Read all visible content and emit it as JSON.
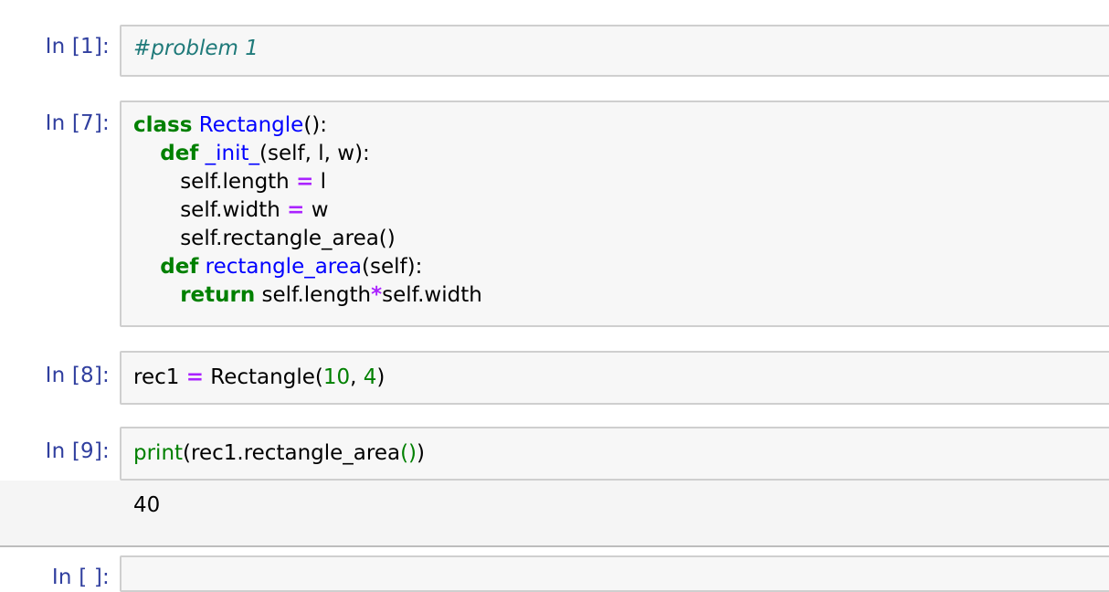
{
  "cells": [
    {
      "prompt": "In [1]:",
      "comment": "#problem 1"
    },
    {
      "prompt": "In [7]:"
    },
    {
      "prompt": "In [8]:"
    },
    {
      "prompt": "In [9]:",
      "output": "40"
    },
    {
      "prompt": "In [ ]:"
    }
  ],
  "code7": {
    "l1_kw": "class",
    "l1_name": "Rectangle",
    "l1_rest": "():",
    "l2_kw": "def",
    "l2_name": "_init_",
    "l2_rest": "(self, l, w):",
    "l3_a": "self.length ",
    "l3_op": "=",
    "l3_b": " l",
    "l4_a": "self.width ",
    "l4_op": "=",
    "l4_b": " w",
    "l5": "self.rectangle_area()",
    "l6_kw": "def",
    "l6_name": "rectangle_area",
    "l6_rest": "(self):",
    "l7_kw": "return",
    "l7_a": " self.length",
    "l7_op": "*",
    "l7_b": "self.width"
  },
  "code8": {
    "a": "rec1 ",
    "op": "=",
    "b": " Rectangle(",
    "n1": "10",
    "c": ", ",
    "n2": "4",
    "d": ")"
  },
  "code9": {
    "bi": "print",
    "a": "(rec1.rectangle_area",
    "p": "()",
    "b": ")"
  }
}
